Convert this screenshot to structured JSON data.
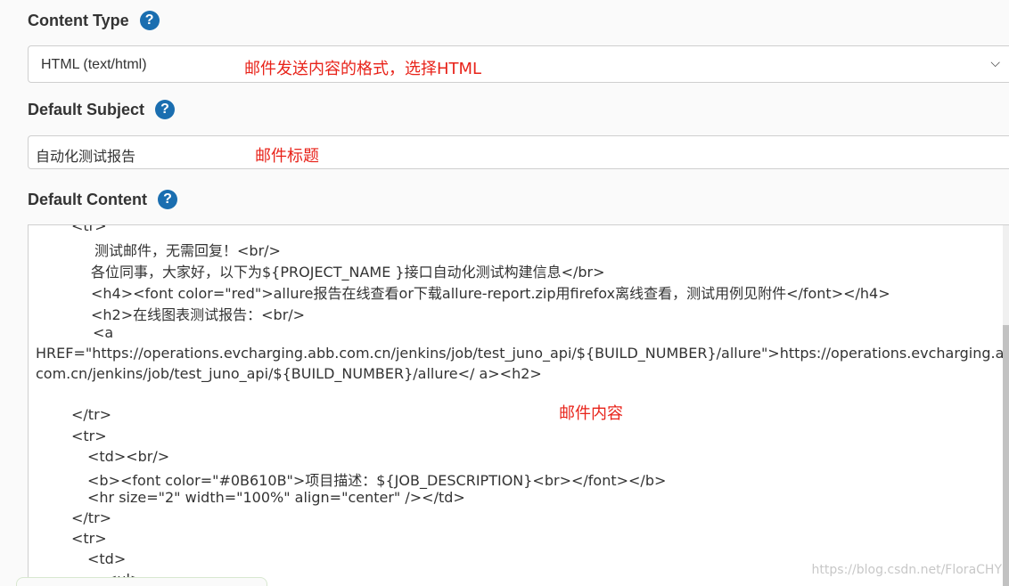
{
  "content_type": {
    "label": "Content Type",
    "help": "?",
    "selected_value": "HTML (text/html)",
    "chevron": "chevron-down-icon",
    "note": "邮件发送内容的格式，选择HTML"
  },
  "default_subject": {
    "label": "Default Subject",
    "help": "?",
    "value": "自动化测试报告",
    "note": "邮件标题"
  },
  "default_content": {
    "label": "Default Content",
    "help": "?",
    "note": "邮件内容",
    "lines": [
      "<tr>",
      "测试邮件，无需回复！<br/>",
      "各位同事，大家好，以下为${PROJECT_NAME }接口自动化测试构建信息</br>",
      "<h4><font color=\"red\">allure报告在线查看or下载allure-report.zip用firefox离线查看，测试用例见附件</font></h4>",
      "<h2>在线图表测试报告：<br/>",
      "<a",
      "HREF=\"https://operations.evcharging.abb.com.cn/jenkins/job/test_juno_api/${BUILD_NUMBER}/allure\">https://operations.evcharging.abb.",
      "com.cn/jenkins/job/test_juno_api/${BUILD_NUMBER}/allure</ a><h2>",
      "</tr>",
      "<tr>",
      "<td><br/>",
      "<b><font color=\"#0B610B\">项目描述：${JOB_DESCRIPTION}<br></font></b>",
      "<hr size=\"2\" width=\"100%\" align=\"center\" /></td>",
      "</tr>",
      "<tr>",
      "<td>",
      "<ul>"
    ]
  },
  "watermark": "https://blog.csdn.net/FloraCHY",
  "colors": {
    "help_icon": "#1a6eb0",
    "note_red": "#e8231a"
  }
}
